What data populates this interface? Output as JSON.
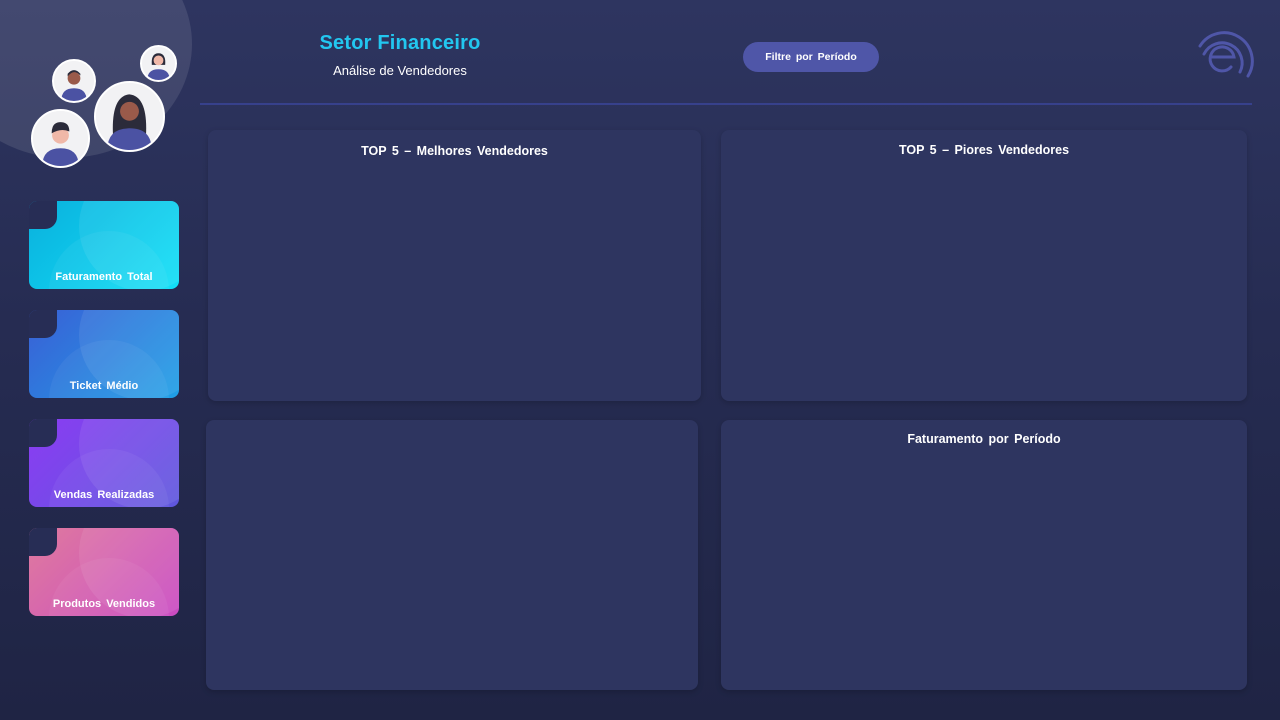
{
  "header": {
    "title": "Setor Financeiro",
    "subtitle": "Análise de Vendedores",
    "filter_label": "Filtre  por Período"
  },
  "kpis": [
    {
      "label": "Faturamento  Total",
      "color": "#12e0f7"
    },
    {
      "label": "Ticket  Médio",
      "color": "#1fa0e6"
    },
    {
      "label": "Vendas  Realizadas",
      "color": "#8c3cf3"
    },
    {
      "label": "Produtos  Vendidos",
      "color": "#c94ac2"
    }
  ],
  "panels": [
    {
      "title": "TOP 5 – Melhores  Vendedores"
    },
    {
      "title": "TOP 5 – Piores Vendedores"
    },
    {
      "title": ""
    },
    {
      "title": "Faturamento  por Período"
    }
  ],
  "icons": {
    "logo": "brand-e-logo-icon",
    "avatars": [
      "person-avatar-icon"
    ]
  },
  "colors": {
    "accent": "#22c7f0",
    "background": "#272d55",
    "panel": "#2e3560",
    "button": "#4f56a8"
  }
}
